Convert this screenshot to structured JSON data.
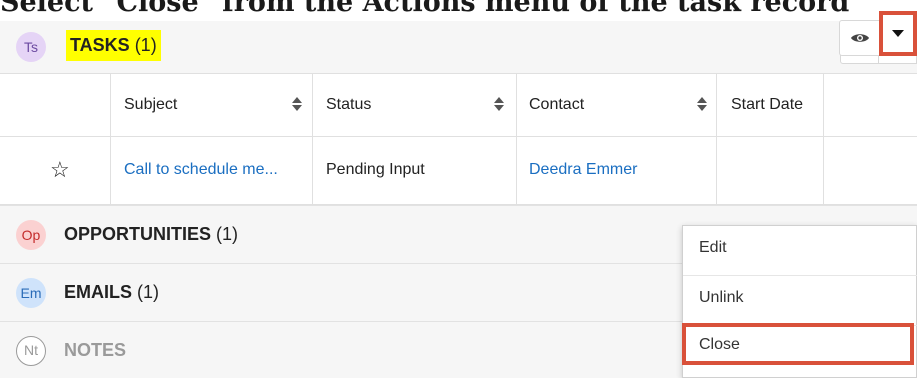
{
  "caption": "Select \"Close\" from the Actions menu of the task record",
  "tasks": {
    "badge": "Ts",
    "title": "TASKS",
    "count": "(1)"
  },
  "table": {
    "headers": [
      "Subject",
      "Status",
      "Contact",
      "Start Date"
    ],
    "row": {
      "subject": "Call to schedule me...",
      "status": "Pending Input",
      "contact": "Deedra Emmer",
      "start_date": ""
    }
  },
  "opportunities": {
    "badge": "Op",
    "title": "OPPORTUNITIES",
    "count": "(1)"
  },
  "emails": {
    "badge": "Em",
    "title": "EMAILS",
    "count": "(1)"
  },
  "notes": {
    "badge": "Nt",
    "title": "NOTES"
  },
  "actions_menu": {
    "items": [
      "Edit",
      "Unlink",
      "Close"
    ]
  },
  "colors": {
    "highlight": "#ffff00",
    "callout": "#d9513a",
    "link": "#1a6ec1"
  },
  "icons": {
    "star": "star-outline-icon",
    "preview": "eye-icon",
    "sort": "sort-icon",
    "add": "plus-icon",
    "menu": "caret-down-icon"
  }
}
